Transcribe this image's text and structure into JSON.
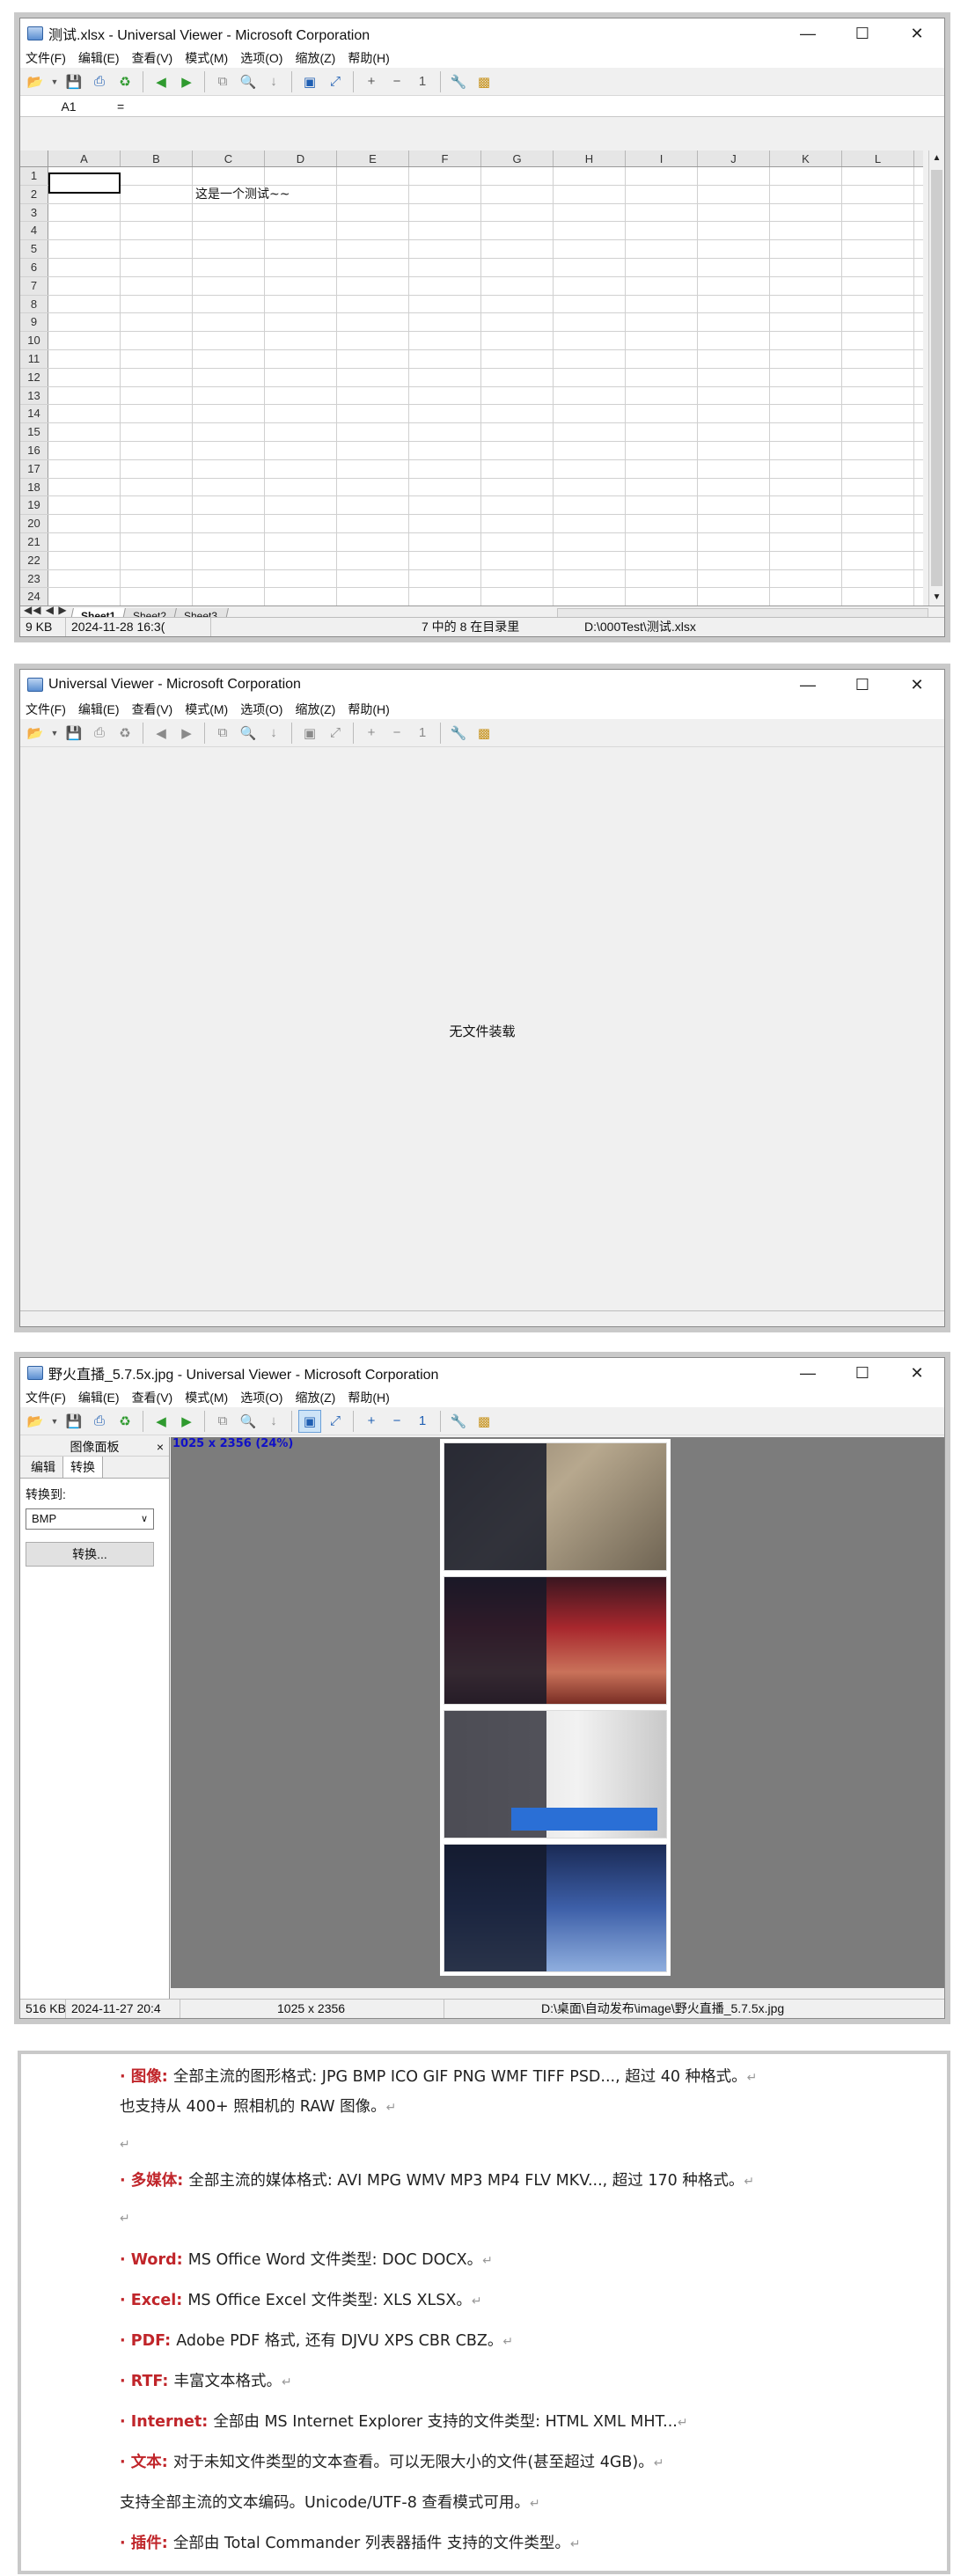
{
  "win1": {
    "title": "测试.xlsx - Universal Viewer - Microsoft Corporation",
    "menu": [
      "文件(F)",
      "编辑(E)",
      "查看(V)",
      "模式(M)",
      "选项(O)",
      "缩放(Z)",
      "帮助(H)"
    ],
    "cell_ref": "A1",
    "formula_sign": "=",
    "columns": [
      "A",
      "B",
      "C",
      "D",
      "E",
      "F",
      "G",
      "H",
      "I",
      "J",
      "K",
      "L"
    ],
    "rows": [
      "1",
      "2",
      "3",
      "4",
      "5",
      "6",
      "7",
      "8",
      "9",
      "10",
      "11",
      "12",
      "13",
      "14",
      "15",
      "16",
      "17",
      "18",
      "19",
      "20",
      "21",
      "22",
      "23",
      "24"
    ],
    "cell_text": "这是一个测试~~",
    "sheets": [
      "Sheet1",
      "Sheet2",
      "Sheet3"
    ],
    "status": [
      "9 KB",
      "2024-11-28 16:3(",
      "7 中的 8 在目录里",
      "D:\\000Test\\测试.xlsx"
    ]
  },
  "win2": {
    "title": "Universal Viewer - Microsoft Corporation",
    "menu": [
      "文件(F)",
      "编辑(E)",
      "查看(V)",
      "模式(M)",
      "选项(O)",
      "缩放(Z)",
      "帮助(H)"
    ],
    "empty_message": "无文件装载"
  },
  "win3": {
    "title": "野火直播_5.7.5x.jpg - Universal Viewer - Microsoft Corporation",
    "menu": [
      "文件(F)",
      "编辑(E)",
      "查看(V)",
      "模式(M)",
      "选项(O)",
      "缩放(Z)",
      "帮助(H)"
    ],
    "panel_title": "图像面板",
    "panel_close": "×",
    "tabs": [
      "编辑",
      "转换"
    ],
    "convert_label": "转换到:",
    "format_value": "BMP",
    "convert_button": "转换...",
    "image_dims": "1025 x 2356 (24%)",
    "status": [
      "516 KB",
      "2024-11-27 20:4",
      "1025 x 2356",
      "D:\\桌面\\自动发布\\image\\野火直播_5.7.5x.jpg"
    ]
  },
  "doc": {
    "items": [
      {
        "kw": "图像",
        "text": "全部主流的图形格式: JPG BMP ICO GIF PNG WMF TIFF PSD..., 超过 40 种格式。"
      },
      {
        "kw": "",
        "text": "也支持从 400+ 照相机的 RAW 图像。"
      },
      {
        "kw": "多媒体",
        "text": "全部主流的媒体格式: AVI MPG WMV MP3 MP4 FLV MKV..., 超过 170 种格式。"
      },
      {
        "kw": "Word",
        "text": "MS Office Word 文件类型: DOC DOCX。"
      },
      {
        "kw": "Excel",
        "text": "MS Office Excel 文件类型: XLS XLSX。"
      },
      {
        "kw": "PDF",
        "text": "Adobe PDF 格式, 还有 DJVU XPS CBR CBZ。"
      },
      {
        "kw": "RTF",
        "text": "丰富文本格式。"
      },
      {
        "kw": "Internet",
        "text": "全部由 MS Internet Explorer 支持的文件类型: HTML XML MHT..."
      },
      {
        "kw": "文本",
        "text": "对于未知文件类型的文本查看。可以无限大小的文件(甚至超过 4GB)。"
      },
      {
        "kw": "",
        "text": "支持全部主流的文本编码。Unicode/UTF-8 查看模式可用。"
      },
      {
        "kw": "插件",
        "text": "全部由 Total Commander 列表器插件 支持的文件类型。"
      }
    ],
    "return_mark": "↵"
  }
}
